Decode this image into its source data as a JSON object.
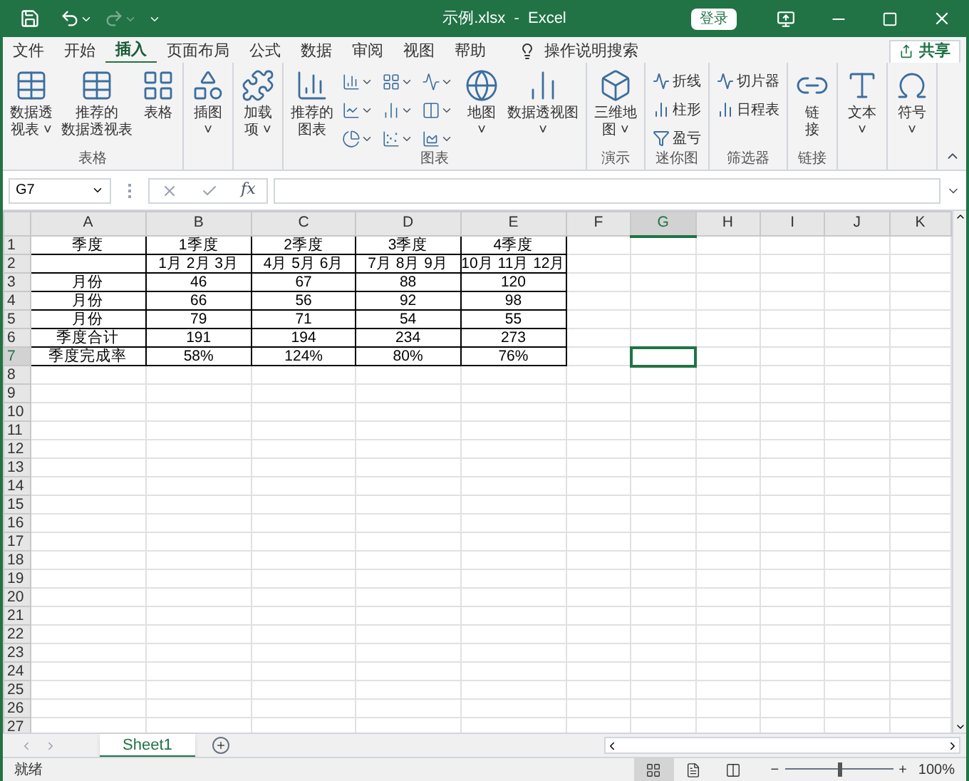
{
  "window": {
    "title": "示例.xlsx  -  Excel",
    "sign_in": "登录"
  },
  "quick_access": {
    "redo_disabled": true
  },
  "menu_tabs": [
    {
      "label": "文件",
      "selected": false
    },
    {
      "label": "开始",
      "selected": false
    },
    {
      "label": "插入",
      "selected": true
    },
    {
      "label": "页面布局",
      "selected": false
    },
    {
      "label": "公式",
      "selected": false
    },
    {
      "label": "数据",
      "selected": false
    },
    {
      "label": "审阅",
      "selected": false
    },
    {
      "label": "视图",
      "selected": false
    },
    {
      "label": "帮助",
      "selected": false
    }
  ],
  "tell_me": "操作说明搜索",
  "share": "共享",
  "ribbon_groups": [
    {
      "label": "表格",
      "items": [
        {
          "kind": "large",
          "lines": [
            "数据透",
            "视表 ˅"
          ]
        },
        {
          "kind": "large",
          "lines": [
            "推荐的",
            "数据透视表"
          ]
        },
        {
          "kind": "large",
          "lines": [
            "表格"
          ]
        }
      ]
    },
    {
      "items": [
        {
          "kind": "large",
          "lines": [
            "插图",
            "˅"
          ]
        }
      ]
    },
    {
      "items": [
        {
          "kind": "large",
          "lines": [
            "加载",
            "项 ˅"
          ]
        }
      ]
    },
    {
      "label": "图表",
      "items": [
        {
          "kind": "large",
          "lines": [
            "推荐的",
            "图表"
          ]
        },
        {
          "kind": "chartgrid"
        },
        {
          "kind": "large",
          "lines": [
            "地图",
            "˅"
          ]
        },
        {
          "kind": "large",
          "lines": [
            "数据透视图",
            "˅"
          ]
        }
      ]
    },
    {
      "label": "演示",
      "items": [
        {
          "kind": "large",
          "lines": [
            "三维地",
            "图 ˅"
          ]
        }
      ]
    },
    {
      "label": "迷你图",
      "items": [
        {
          "kind": "small",
          "entries": [
            "折线",
            "柱形",
            "盈亏"
          ]
        }
      ]
    },
    {
      "label": "筛选器",
      "items": [
        {
          "kind": "small",
          "entries": [
            "切片器",
            "日程表"
          ]
        }
      ]
    },
    {
      "label": "链接",
      "items": [
        {
          "kind": "large",
          "lines": [
            "链",
            "接"
          ]
        }
      ]
    },
    {
      "items": [
        {
          "kind": "large",
          "lines": [
            "文本",
            "˅"
          ]
        }
      ]
    },
    {
      "items": [
        {
          "kind": "large",
          "lines": [
            "符号",
            "˅"
          ]
        }
      ]
    }
  ],
  "name_box": "G7",
  "function_label": "fx",
  "columns": [
    {
      "label": "A",
      "selected": false
    },
    {
      "label": "B",
      "selected": false
    },
    {
      "label": "C",
      "selected": false
    },
    {
      "label": "D",
      "selected": false
    },
    {
      "label": "E",
      "selected": false
    },
    {
      "label": "F",
      "selected": false
    },
    {
      "label": "G",
      "selected": true
    },
    {
      "label": "H",
      "selected": false
    },
    {
      "label": "I",
      "selected": false
    },
    {
      "label": "J",
      "selected": false
    },
    {
      "label": "K",
      "selected": false
    }
  ],
  "rows": [
    {
      "label": "1",
      "selected": false,
      "cells": [
        "季度",
        "1季度",
        "2季度",
        "3季度",
        "4季度"
      ]
    },
    {
      "label": "2",
      "selected": false,
      "cells": [
        null,
        "1月 2月 3月",
        "4月 5月 6月",
        "7月 8月 9月",
        "10月 11月 12月"
      ]
    },
    {
      "label": "3",
      "selected": false,
      "cells": [
        "月份",
        "46",
        "67",
        "88",
        "120"
      ]
    },
    {
      "label": "4",
      "selected": false,
      "cells": [
        "月份",
        "66",
        "56",
        "92",
        "98"
      ]
    },
    {
      "label": "5",
      "selected": false,
      "cells": [
        "月份",
        "79",
        "71",
        "54",
        "55"
      ]
    },
    {
      "label": "6",
      "selected": false,
      "cells": [
        "季度合计",
        "191",
        "194",
        "234",
        "273"
      ]
    },
    {
      "label": "7",
      "selected": true,
      "cells": [
        "季度完成率",
        "58%",
        "124%",
        "80%",
        "76%"
      ]
    },
    {
      "label": "8",
      "selected": false
    },
    {
      "label": "9",
      "selected": false
    },
    {
      "label": "10",
      "selected": false
    },
    {
      "label": "11",
      "selected": false
    },
    {
      "label": "12",
      "selected": false
    },
    {
      "label": "13",
      "selected": false
    },
    {
      "label": "14",
      "selected": false
    },
    {
      "label": "15",
      "selected": false
    },
    {
      "label": "16",
      "selected": false
    },
    {
      "label": "17",
      "selected": false
    },
    {
      "label": "18",
      "selected": false
    },
    {
      "label": "19",
      "selected": false
    },
    {
      "label": "20",
      "selected": false
    },
    {
      "label": "21",
      "selected": false
    },
    {
      "label": "22",
      "selected": false
    },
    {
      "label": "23",
      "selected": false
    },
    {
      "label": "24",
      "selected": false
    },
    {
      "label": "25",
      "selected": false
    },
    {
      "label": "26",
      "selected": false
    },
    {
      "label": "27",
      "selected": false
    }
  ],
  "sheet_tabs": [
    {
      "label": "Sheet1",
      "selected": true
    }
  ],
  "status_bar": {
    "status": "就绪",
    "views": [
      {
        "kind": "normal",
        "selected": true
      },
      {
        "kind": "layout",
        "selected": false
      },
      {
        "kind": "pagebreak",
        "selected": false
      }
    ],
    "zoom_minus": "−",
    "zoom_plus": "+",
    "zoom": {
      "level": 0.5
    },
    "zoom_text": "100%"
  }
}
